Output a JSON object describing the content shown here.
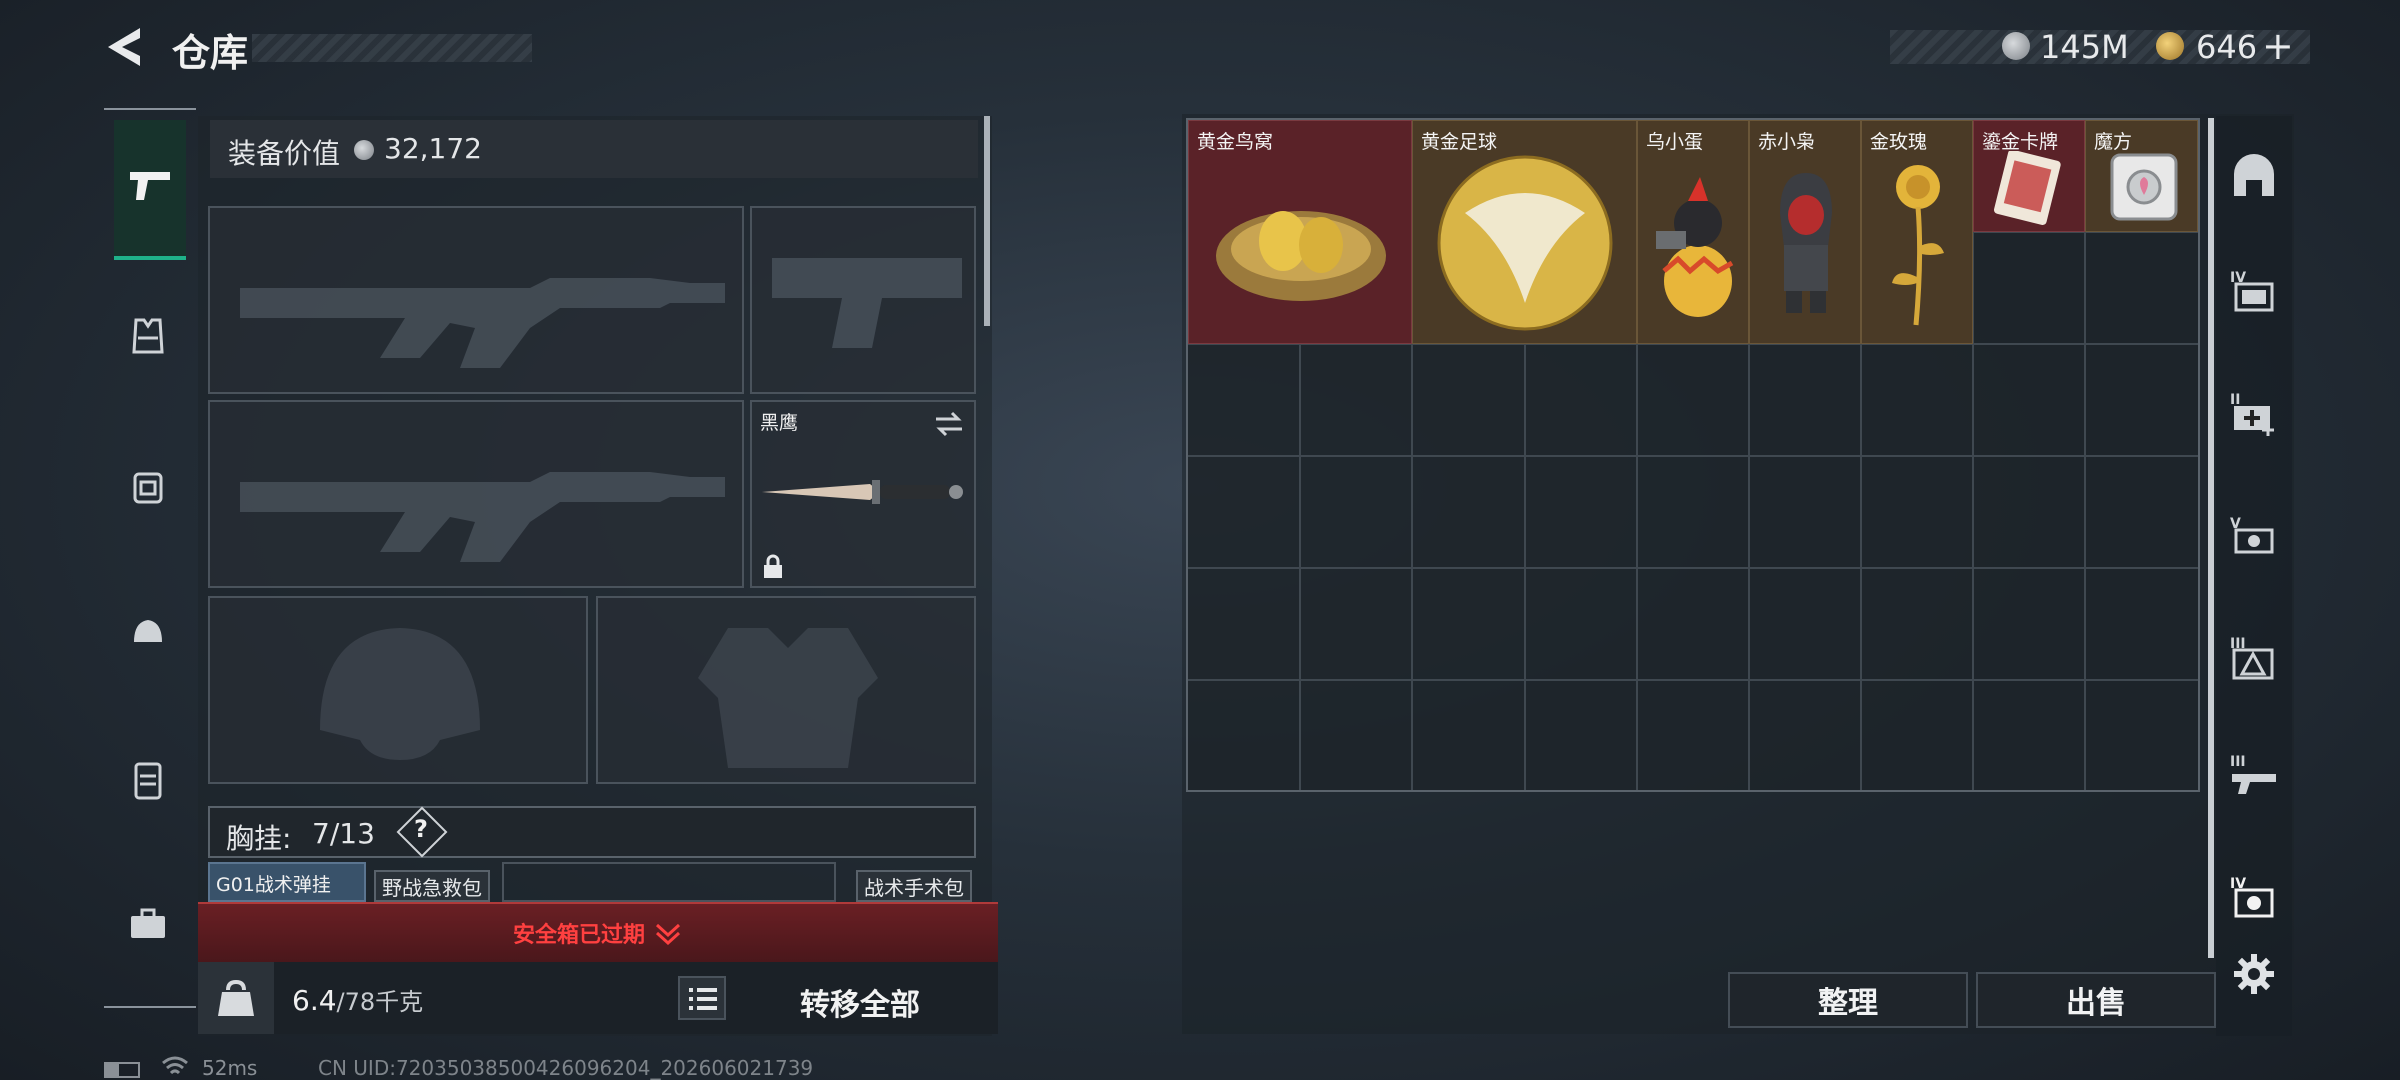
{
  "header": {
    "title": "仓库",
    "currency1": "145M",
    "currency2": "646",
    "currency2_add": "+"
  },
  "left_tabs": [
    {
      "icon": "pistol-icon",
      "active": true
    },
    {
      "icon": "vest-icon"
    },
    {
      "icon": "backpack-icon"
    },
    {
      "icon": "helmet-bag-icon"
    },
    {
      "icon": "canister-icon"
    },
    {
      "icon": "toolbox-icon"
    }
  ],
  "loadout": {
    "equipment_value_label": "装备价值",
    "equipment_value": "32,172",
    "melee_name": "黑鹰",
    "chest_rig_label": "胸挂:",
    "chest_rig_count": "7/13",
    "chest_rig_help": "?",
    "pouch_items": [
      "G01战术弹挂",
      "野战急救包",
      "战术手术包"
    ],
    "expired_notice": "安全箱已过期",
    "weight_current": "6.4",
    "weight_max": "/78千克",
    "transfer_all": "转移全部"
  },
  "stash": {
    "items": [
      {
        "name": "黄金鸟窝",
        "rarity": "red"
      },
      {
        "name": "黄金足球",
        "rarity": "gold"
      },
      {
        "name": "乌小蛋",
        "rarity": "gold"
      },
      {
        "name": "赤小枭",
        "rarity": "gold"
      },
      {
        "name": "金玫瑰",
        "rarity": "gold"
      },
      {
        "name": "鎏金卡牌",
        "rarity": "red"
      },
      {
        "name": "魔方",
        "rarity": "gold"
      }
    ],
    "sort_button": "整理",
    "sell_button": "出售"
  },
  "right_tabs": [
    "house-icon",
    "folder-iv-icon",
    "medkit-ii-icon",
    "camera-v-icon",
    "triangle-iii-icon",
    "gun-iii-icon",
    "camera-iv-icon",
    "gear-icon"
  ],
  "status": {
    "ping": "52ms",
    "uid": "CN UID:720350385004260962​04_202606021739"
  },
  "colors": {
    "red_rarity": "#5a2228",
    "gold_rarity": "#4a3a26",
    "alert_red": "#ff3b3b",
    "active_tab": "#1fb28a"
  }
}
